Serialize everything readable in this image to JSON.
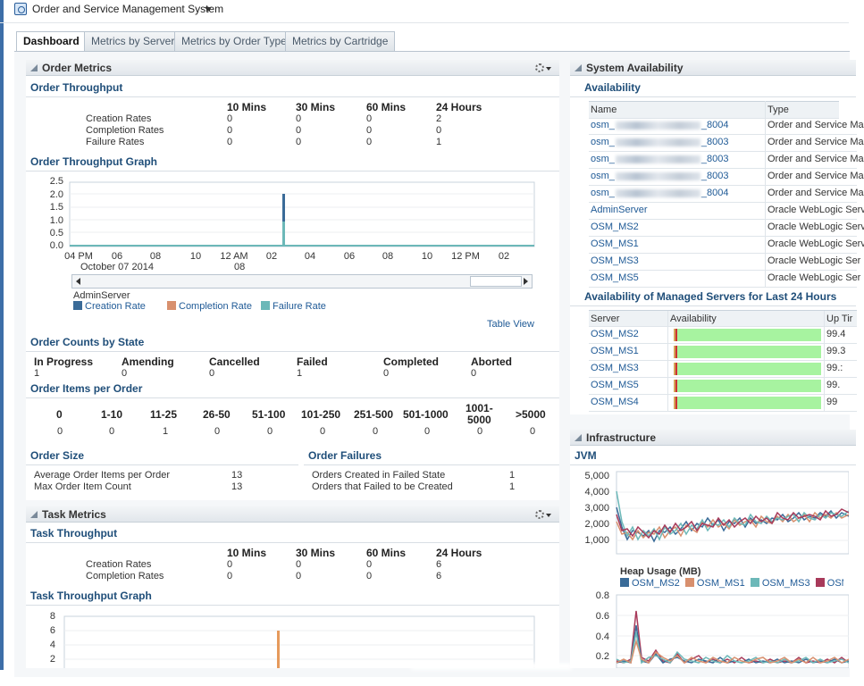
{
  "app": {
    "title": "Order and Service Management System"
  },
  "tabs": [
    "Dashboard",
    "Metrics by Server",
    "Metrics by Order Type",
    "Metrics by Cartridge"
  ],
  "order_metrics": {
    "title": "Order Metrics",
    "throughput": {
      "title": "Order Throughput",
      "columns": [
        "10 Mins",
        "30 Mins",
        "60 Mins",
        "24 Hours"
      ],
      "rows": [
        {
          "label": "Creation Rates",
          "values": [
            "0",
            "0",
            "0",
            "2"
          ]
        },
        {
          "label": "Completion Rates",
          "values": [
            "0",
            "0",
            "0",
            "0"
          ]
        },
        {
          "label": "Failure Rates",
          "values": [
            "0",
            "0",
            "0",
            "1"
          ]
        }
      ]
    },
    "graph": {
      "title": "Order Throughput Graph",
      "y_ticks": [
        "2.5",
        "2.0",
        "1.5",
        "1.0",
        "0.5",
        "0.0"
      ],
      "x_ticks": [
        "04 PM",
        "06",
        "08",
        "10",
        "12 AM",
        "02",
        "04",
        "06",
        "08",
        "10",
        "12 PM",
        "02"
      ],
      "date_label": "October 07 2014",
      "date_label2": "08",
      "server": "AdminServer",
      "legend": [
        "Creation Rate",
        "Completion Rate",
        "Failure Rate"
      ],
      "colors": [
        "#3a6b98",
        "#d8906e",
        "#6cb8b8"
      ],
      "table_view": "Table View"
    },
    "counts": {
      "title": "Order Counts by State",
      "states": [
        {
          "label": "In Progress",
          "value": "1"
        },
        {
          "label": "Amending",
          "value": "0"
        },
        {
          "label": "Cancelled",
          "value": "0"
        },
        {
          "label": "Failed",
          "value": "1"
        },
        {
          "label": "Completed",
          "value": "0"
        },
        {
          "label": "Aborted",
          "value": "0"
        }
      ]
    },
    "items": {
      "title": "Order Items per Order",
      "buckets": [
        {
          "label": "0",
          "value": "0"
        },
        {
          "label": "1-10",
          "value": "0"
        },
        {
          "label": "11-25",
          "value": "1"
        },
        {
          "label": "26-50",
          "value": "0"
        },
        {
          "label": "51-100",
          "value": "0"
        },
        {
          "label": "101-250",
          "value": "0"
        },
        {
          "label": "251-500",
          "value": "0"
        },
        {
          "label": "501-1000",
          "value": "0"
        },
        {
          "label": "1001-",
          "label2": "5000",
          "value": "0"
        },
        {
          "label": ">5000",
          "value": "0"
        }
      ]
    },
    "size": {
      "title": "Order Size",
      "rows": [
        {
          "label": "Average Order Items per Order",
          "value": "13"
        },
        {
          "label": "Max Order Item Count",
          "value": "13"
        }
      ]
    },
    "failures": {
      "title": "Order Failures",
      "rows": [
        {
          "label": "Orders Created in Failed State",
          "value": "1"
        },
        {
          "label": "Orders that Failed to be Created",
          "value": "1"
        }
      ]
    }
  },
  "task_metrics": {
    "title": "Task Metrics",
    "throughput": {
      "title": "Task Throughput",
      "columns": [
        "10 Mins",
        "30 Mins",
        "60 Mins",
        "24 Hours"
      ],
      "rows": [
        {
          "label": "Creation Rates",
          "values": [
            "0",
            "0",
            "0",
            "6"
          ]
        },
        {
          "label": "Completion Rates",
          "values": [
            "0",
            "0",
            "0",
            "6"
          ]
        }
      ]
    },
    "graph": {
      "title": "Task Throughput Graph",
      "y_ticks": [
        "8",
        "6",
        "4",
        "2"
      ]
    }
  },
  "system_availability": {
    "title": "System Availability",
    "availability": {
      "title": "Availability",
      "columns": [
        "Name",
        "Type"
      ],
      "rows": [
        {
          "prefix": "osm_",
          "suffix": "_8004",
          "type": "Order and Service Ma"
        },
        {
          "prefix": "osm_",
          "suffix": "_8003",
          "type": "Order and Service Mar"
        },
        {
          "prefix": "osm_",
          "suffix": "_8003",
          "type": "Order and Service Mar"
        },
        {
          "prefix": "osm_",
          "suffix": "_8003",
          "type": "Order and Service Mar"
        },
        {
          "prefix": "osm_",
          "suffix": "_8004",
          "type": "Order and Service Mar"
        },
        {
          "prefix": "AdminServer",
          "suffix": "",
          "type": "Oracle WebLogic Serv"
        },
        {
          "prefix": "OSM_MS2",
          "suffix": "",
          "type": "Oracle WebLogic Serv"
        },
        {
          "prefix": "OSM_MS1",
          "suffix": "",
          "type": "Oracle WebLogic Serv"
        },
        {
          "prefix": "OSM_MS3",
          "suffix": "",
          "type": "Oracle WebLogic Ser"
        },
        {
          "prefix": "OSM_MS5",
          "suffix": "",
          "type": "Oracle WebLogic Ser"
        }
      ]
    },
    "managed": {
      "title": "Availability of Managed Servers for Last 24 Hours",
      "columns": [
        "Server",
        "Availability",
        "Up Tir"
      ],
      "rows": [
        {
          "server": "OSM_MS2",
          "uptime": "99.4"
        },
        {
          "server": "OSM_MS1",
          "uptime": "99.3"
        },
        {
          "server": "OSM_MS3",
          "uptime": "99.:"
        },
        {
          "server": "OSM_MS5",
          "uptime": "99."
        },
        {
          "server": "OSM_MS4",
          "uptime": "99"
        }
      ]
    }
  },
  "infrastructure": {
    "title": "Infrastructure",
    "jvm": {
      "title": "JVM",
      "y_ticks": [
        "5,000",
        "4,000",
        "3,000",
        "2,000",
        "1,000"
      ],
      "heap_label": "Heap Usage (MB)",
      "legend": [
        "OSM_MS2",
        "OSM_MS1",
        "OSM_MS3",
        "OSM"
      ],
      "colors": [
        "#3a6b98",
        "#d8906e",
        "#6cb8b8",
        "#a83a5a"
      ],
      "y_ticks2": [
        "0.8",
        "0.6",
        "0.4",
        "0.2"
      ]
    }
  }
}
